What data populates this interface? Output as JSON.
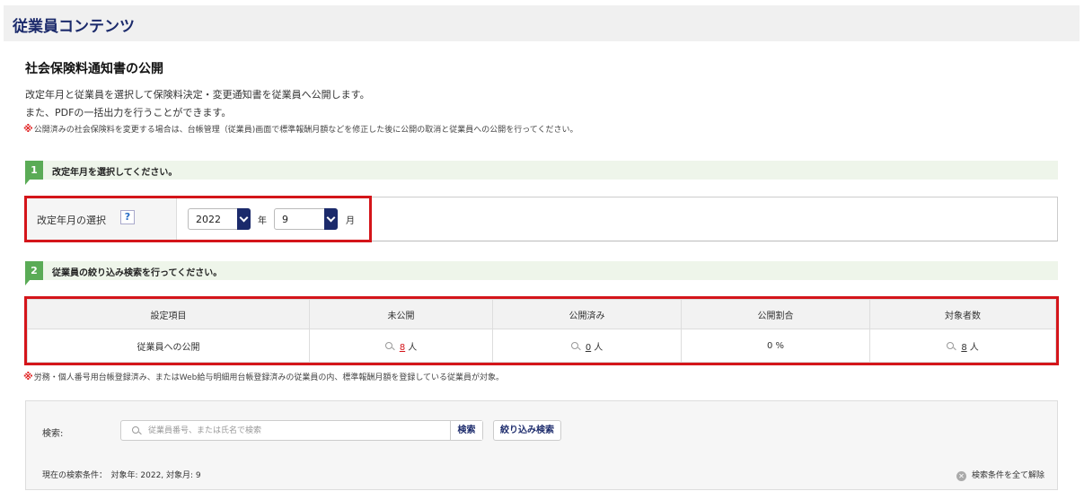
{
  "app": {
    "title": "従業員コンテンツ"
  },
  "page": {
    "title": "社会保険料通知書の公開",
    "description_1": "改定年月と従業員を選択して保険料決定・変更通知書を従業員へ公開します。",
    "description_2": "また、PDFの一括出力を行うことができます。",
    "note_mark": "※",
    "note": "公開済みの社会保険料を変更する場合は、台帳管理（従業員)画面で標準報酬月額などを修正した後に公開の取消と従業員への公開を行ってください。"
  },
  "step1": {
    "number": "1",
    "text": "改定年月を選択してください。",
    "label": "改定年月の選択",
    "help_glyph": "?",
    "year_value": "2022",
    "year_unit": "年",
    "month_value": "9",
    "month_unit": "月"
  },
  "step2": {
    "number": "2",
    "text": "従業員の絞り込み検索を行ってください。"
  },
  "summary_table": {
    "headers": [
      "設定項目",
      "未公開",
      "公開済み",
      "公開割合",
      "対象者数"
    ],
    "row": {
      "item": "従業員への公開",
      "unpublished": "8",
      "published": "0",
      "ratio": "0 %",
      "target": "8",
      "person_unit": "人"
    }
  },
  "note2": {
    "mark": "※",
    "text": "労務・個人番号用台帳登録済み、またはWeb給与明細用台帳登録済みの従業員の内、標準報酬月額を登録している従業員が対象。"
  },
  "search": {
    "label": "検索:",
    "placeholder": "従業員番号、または氏名で検索",
    "value": "",
    "search_button": "検索",
    "filter_button": "絞り込み検索",
    "conditions": "現在の検索条件：　対象年: 2022, 対象月: 9",
    "clear_glyph": "✕",
    "clear_all": "検索条件を全て解除"
  },
  "colors": {
    "brand_navy": "#1b2a6b",
    "step_green": "#5aab56",
    "highlight_red": "#d4151a"
  },
  "icons": [
    "search-icon",
    "help-icon",
    "chevron-down-icon",
    "clear-icon"
  ]
}
